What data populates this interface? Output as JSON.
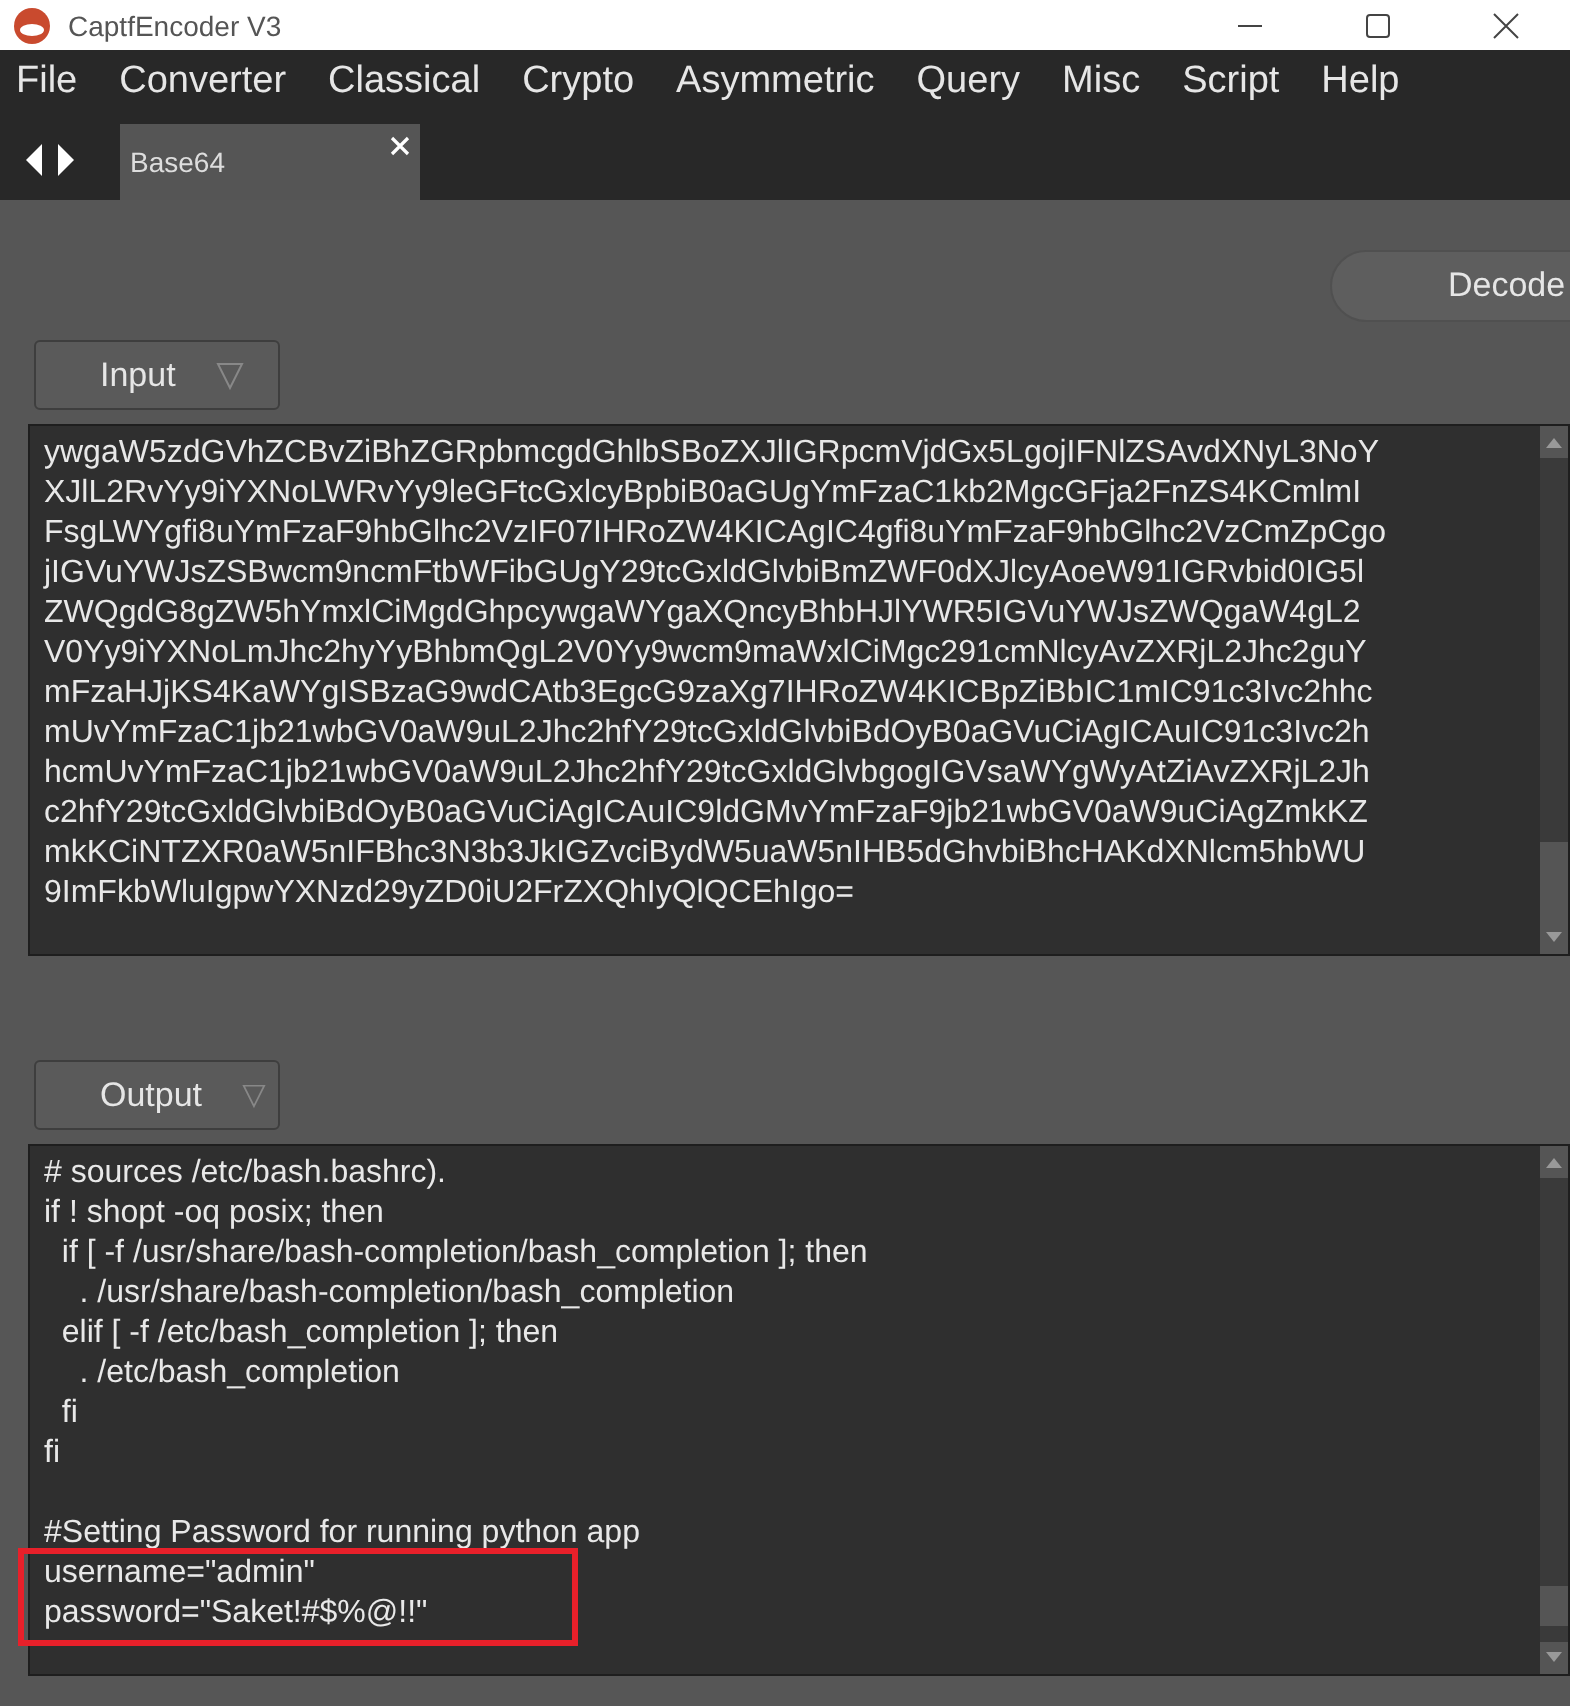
{
  "window": {
    "title": "CaptfEncoder V3"
  },
  "menu": [
    "File",
    "Converter",
    "Classical",
    "Crypto",
    "Asymmetric",
    "Query",
    "Misc",
    "Script",
    "Help"
  ],
  "tabs": [
    {
      "label": "Base64",
      "selected": true
    }
  ],
  "decode_button": "Decode",
  "input": {
    "label": "Input",
    "lines": [
      "ywgaW5zdGVhZCBvZiBhZGRpbmcgdGhlbSBoZXJlIGRpcmVjdGx5LgojIFNlZSAvdXNyL3NoY",
      "XJlL2RvYy9iYXNoLWRvYy9leGFtcGxlcyBpbiB0aGUgYmFzaC1kb2MgcGFja2FnZS4KCmlmI",
      "FsgLWYgfi8uYmFzaF9hbGlhc2VzIF07IHRoZW4KICAgIC4gfi8uYmFzaF9hbGlhc2VzCmZpCgo",
      "jIGVuYWJsZSBwcm9ncmFtbWFibGUgY29tcGxldGlvbiBmZWF0dXJlcyAoeW91IGRvbid0IG5l",
      "ZWQgdG8gZW5hYmxlCiMgdGhpcywgaWYgaXQncyBhbHJlYWR5IGVuYWJsZWQgaW4gL2",
      "V0Yy9iYXNoLmJhc2hyYyBhbmQgL2V0Yy9wcm9maWxlCiMgc291cmNlcyAvZXRjL2Jhc2guY",
      "mFzaHJjKS4KaWYgISBzaG9wdCAtb3EgcG9zaXg7IHRoZW4KICBpZiBbIC1mIC91c3Ivc2hhc",
      "mUvYmFzaC1jb21wbGV0aW9uL2Jhc2hfY29tcGxldGlvbiBdOyB0aGVuCiAgICAuIC91c3Ivc2h",
      "hcmUvYmFzaC1jb21wbGV0aW9uL2Jhc2hfY29tcGxldGlvbgogIGVsaWYgWyAtZiAvZXRjL2Jh",
      "c2hfY29tcGxldGlvbiBdOyB0aGVuCiAgICAuIC9ldGMvYmFzaF9jb21wbGV0aW9uCiAgZmkKZ",
      "mkKCiNTZXR0aW5nIFBhc3N3b3JkIGZvciBydW5uaW5nIHB5dGhvbiBhcHAKdXNlcm5hbWU",
      "9ImFkbWluIgpwYXNzd29yZD0iU2FrZXQhIyQlQCEhIgo="
    ]
  },
  "output": {
    "label": "Output",
    "lines": [
      {
        "text": "# sources /etc/bash.bashrc).",
        "highlighted": false
      },
      {
        "text": "if ! shopt -oq posix; then",
        "highlighted": false
      },
      {
        "text": "  if [ -f /usr/share/bash-completion/bash_completion ]; then",
        "highlighted": false
      },
      {
        "text": "    . /usr/share/bash-completion/bash_completion",
        "highlighted": false
      },
      {
        "text": "  elif [ -f /etc/bash_completion ]; then",
        "highlighted": false
      },
      {
        "text": "    . /etc/bash_completion",
        "highlighted": false
      },
      {
        "text": "  fi",
        "highlighted": false
      },
      {
        "text": "fi",
        "highlighted": false
      },
      {
        "highlighted": false
      },
      {
        "text": "#Setting Password for running python app",
        "highlighted": false
      },
      {
        "text": "username=\"admin\"",
        "highlighted": true
      },
      {
        "text": "password=\"Saket!#$%@!!\"",
        "highlighted": true
      }
    ]
  }
}
